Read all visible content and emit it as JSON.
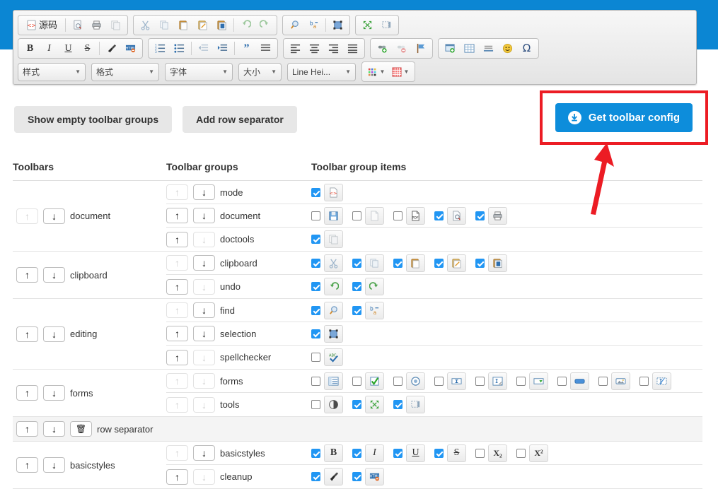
{
  "editor_toolbar": {
    "row1": [
      {
        "group": "document-mode",
        "buttons": [
          {
            "name": "source-button",
            "label": "源码",
            "icon": "source-code-icon"
          },
          {
            "name": "preview-button",
            "label": "",
            "icon": "preview-icon"
          },
          {
            "name": "print-button",
            "label": "",
            "icon": "print-icon"
          },
          {
            "name": "templates-button",
            "label": "",
            "icon": "templates-icon"
          }
        ]
      },
      {
        "group": "clipboard-undo",
        "buttons": [
          {
            "name": "cut-button",
            "label": "",
            "icon": "scissors-icon"
          },
          {
            "name": "copy-button",
            "label": "",
            "icon": "copy-icon"
          },
          {
            "name": "paste-button",
            "label": "",
            "icon": "paste-icon"
          },
          {
            "name": "paste-text-button",
            "label": "",
            "icon": "paste-text-icon"
          },
          {
            "name": "paste-word-button",
            "label": "",
            "icon": "paste-from-word-icon"
          },
          {
            "name": "undo-button",
            "label": "",
            "icon": "undo-icon"
          },
          {
            "name": "redo-button",
            "label": "",
            "icon": "redo-icon"
          }
        ]
      },
      {
        "group": "editing",
        "buttons": [
          {
            "name": "find-button",
            "label": "",
            "icon": "magnifier-icon"
          },
          {
            "name": "replace-button",
            "label": "",
            "icon": "find-replace-icon"
          },
          {
            "name": "select-all-button",
            "label": "",
            "icon": "select-all-icon"
          }
        ]
      },
      {
        "group": "tools",
        "buttons": [
          {
            "name": "maximize-button",
            "label": "",
            "icon": "maximize-icon"
          },
          {
            "name": "show-blocks-button",
            "label": "",
            "icon": "show-blocks-icon"
          }
        ]
      }
    ],
    "row2": [
      {
        "group": "basicstyles-cleanup",
        "buttons": [
          {
            "name": "bold-button",
            "label": "B",
            "icon": "bold-icon"
          },
          {
            "name": "italic-button",
            "label": "I",
            "icon": "italic-icon"
          },
          {
            "name": "underline-button",
            "label": "U",
            "icon": "underline-icon"
          },
          {
            "name": "strike-button",
            "label": "S",
            "icon": "strike-icon"
          },
          {
            "name": "remove-format-button",
            "label": "",
            "icon": "brush-icon"
          },
          {
            "name": "html-cleanup-button",
            "label": "",
            "icon": "html-remove-icon"
          }
        ]
      },
      {
        "group": "list-indent-blockquote",
        "buttons": [
          {
            "name": "numbered-list-button",
            "label": "",
            "icon": "numbered-list-icon"
          },
          {
            "name": "bulleted-list-button",
            "label": "",
            "icon": "bulleted-list-icon"
          },
          {
            "name": "outdent-button",
            "label": "",
            "icon": "outdent-icon"
          },
          {
            "name": "indent-button",
            "label": "",
            "icon": "indent-icon"
          },
          {
            "name": "blockquote-button",
            "label": "",
            "icon": "quote-icon"
          },
          {
            "name": "div-button",
            "label": "",
            "icon": "create-div-icon"
          }
        ]
      },
      {
        "group": "align",
        "buttons": [
          {
            "name": "align-left-button",
            "label": "",
            "icon": "align-left-icon"
          },
          {
            "name": "align-center-button",
            "label": "",
            "icon": "align-center-icon"
          },
          {
            "name": "align-right-button",
            "label": "",
            "icon": "align-right-icon"
          },
          {
            "name": "align-justify-button",
            "label": "",
            "icon": "align-justify-icon"
          }
        ]
      },
      {
        "group": "links",
        "buttons": [
          {
            "name": "link-button",
            "label": "",
            "icon": "link-icon"
          },
          {
            "name": "unlink-button",
            "label": "",
            "icon": "unlink-icon"
          },
          {
            "name": "anchor-button",
            "label": "",
            "icon": "anchor-flag-icon"
          }
        ]
      },
      {
        "group": "insert",
        "buttons": [
          {
            "name": "image-button",
            "label": "",
            "icon": "image-icon"
          },
          {
            "name": "table-button",
            "label": "",
            "icon": "table-icon"
          },
          {
            "name": "horizontal-rule-button",
            "label": "",
            "icon": "horizontal-rule-icon"
          },
          {
            "name": "smiley-button",
            "label": "",
            "icon": "smiley-icon"
          },
          {
            "name": "special-char-button",
            "label": "Ω",
            "icon": "omega-icon"
          }
        ]
      }
    ],
    "row3_combos": [
      {
        "name": "styles-combo",
        "label": "样式"
      },
      {
        "name": "format-combo",
        "label": "格式"
      },
      {
        "name": "font-combo",
        "label": "字体"
      },
      {
        "name": "fontsize-combo",
        "label": "大小"
      },
      {
        "name": "lineheight-combo",
        "label": "Line Hei..."
      }
    ],
    "row3_color": [
      {
        "name": "text-color-button",
        "icon": "text-color-icon"
      },
      {
        "name": "background-color-button",
        "icon": "bg-color-icon"
      }
    ]
  },
  "actions": {
    "show_empty": "Show empty toolbar groups",
    "add_row_separator": "Add row separator",
    "get_toolbar_config": "Get toolbar config",
    "get_config_icon": "download-icon",
    "highlight_color": "#ec1c24",
    "primary_color": "#0d8ddb"
  },
  "table": {
    "headers": {
      "toolbars": "Toolbars",
      "groups": "Toolbar groups",
      "items": "Toolbar group items"
    },
    "rows": [
      {
        "type": "toolbar",
        "name": "document",
        "up_enabled": false,
        "down_enabled": true,
        "groups": [
          {
            "name": "mode",
            "up_enabled": false,
            "down_enabled": true,
            "items": [
              {
                "name": "source",
                "checked": true,
                "icon": "source-code-icon"
              }
            ]
          },
          {
            "name": "document",
            "up_enabled": true,
            "down_enabled": true,
            "items": [
              {
                "name": "save",
                "checked": false,
                "icon": "save-icon"
              },
              {
                "name": "newpage",
                "checked": false,
                "icon": "new-page-icon"
              },
              {
                "name": "exportpdf",
                "checked": false,
                "icon": "pdf-icon"
              },
              {
                "name": "preview",
                "checked": true,
                "icon": "preview-icon"
              },
              {
                "name": "print",
                "checked": true,
                "icon": "print-icon"
              }
            ]
          },
          {
            "name": "doctools",
            "up_enabled": true,
            "down_enabled": false,
            "items": [
              {
                "name": "templates",
                "checked": true,
                "icon": "templates-icon"
              }
            ]
          }
        ]
      },
      {
        "type": "toolbar",
        "name": "clipboard",
        "up_enabled": true,
        "down_enabled": true,
        "groups": [
          {
            "name": "clipboard",
            "up_enabled": false,
            "down_enabled": true,
            "items": [
              {
                "name": "cut",
                "checked": true,
                "icon": "scissors-icon"
              },
              {
                "name": "copy",
                "checked": true,
                "icon": "copy-icon"
              },
              {
                "name": "paste",
                "checked": true,
                "icon": "paste-icon"
              },
              {
                "name": "pastetext",
                "checked": true,
                "icon": "paste-text-icon"
              },
              {
                "name": "pastefromword",
                "checked": true,
                "icon": "paste-from-word-icon"
              }
            ]
          },
          {
            "name": "undo",
            "up_enabled": true,
            "down_enabled": false,
            "items": [
              {
                "name": "undo",
                "checked": true,
                "icon": "undo-icon"
              },
              {
                "name": "redo",
                "checked": true,
                "icon": "redo-icon"
              }
            ]
          }
        ]
      },
      {
        "type": "toolbar",
        "name": "editing",
        "up_enabled": true,
        "down_enabled": true,
        "groups": [
          {
            "name": "find",
            "up_enabled": false,
            "down_enabled": true,
            "items": [
              {
                "name": "find",
                "checked": true,
                "icon": "magnifier-icon"
              },
              {
                "name": "replace",
                "checked": true,
                "icon": "find-replace-icon"
              }
            ]
          },
          {
            "name": "selection",
            "up_enabled": true,
            "down_enabled": true,
            "items": [
              {
                "name": "selectall",
                "checked": true,
                "icon": "select-all-icon"
              }
            ]
          },
          {
            "name": "spellchecker",
            "up_enabled": true,
            "down_enabled": false,
            "items": [
              {
                "name": "spellchecker",
                "checked": false,
                "icon": "spellcheck-icon"
              }
            ]
          }
        ]
      },
      {
        "type": "toolbar",
        "name": "forms",
        "up_enabled": true,
        "down_enabled": true,
        "groups": [
          {
            "name": "forms",
            "up_enabled": false,
            "down_enabled": false,
            "items": [
              {
                "name": "form",
                "checked": false,
                "icon": "form-icon"
              },
              {
                "name": "checkbox",
                "checked": false,
                "icon": "checkbox-icon"
              },
              {
                "name": "radio",
                "checked": false,
                "icon": "radio-icon"
              },
              {
                "name": "textfield",
                "checked": false,
                "icon": "text-field-icon"
              },
              {
                "name": "textarea",
                "checked": false,
                "icon": "textarea-icon"
              },
              {
                "name": "select",
                "checked": false,
                "icon": "select-field-icon"
              },
              {
                "name": "button",
                "checked": false,
                "icon": "button-icon"
              },
              {
                "name": "imagebutton",
                "checked": false,
                "icon": "image-button-icon"
              },
              {
                "name": "hiddenfield",
                "checked": false,
                "icon": "hidden-field-icon"
              }
            ]
          },
          {
            "name": "tools",
            "up_enabled": false,
            "down_enabled": false,
            "items": [
              {
                "name": "uicolor",
                "checked": false,
                "icon": "ui-color-icon"
              },
              {
                "name": "maximize",
                "checked": true,
                "icon": "maximize-icon"
              },
              {
                "name": "showblocks",
                "checked": true,
                "icon": "show-blocks-icon"
              }
            ]
          }
        ]
      },
      {
        "type": "separator",
        "name": "row separator",
        "up_enabled": true,
        "down_enabled": true,
        "delete_icon": "trash-icon"
      },
      {
        "type": "toolbar",
        "name": "basicstyles",
        "up_enabled": true,
        "down_enabled": true,
        "groups": [
          {
            "name": "basicstyles",
            "up_enabled": false,
            "down_enabled": true,
            "items": [
              {
                "name": "bold",
                "checked": true,
                "icon": "bold-icon",
                "glyph": "B"
              },
              {
                "name": "italic",
                "checked": true,
                "icon": "italic-icon",
                "glyph": "I"
              },
              {
                "name": "underline",
                "checked": true,
                "icon": "underline-icon",
                "glyph": "U"
              },
              {
                "name": "strike",
                "checked": true,
                "icon": "strike-icon",
                "glyph": "S"
              },
              {
                "name": "subscript",
                "checked": false,
                "icon": "subscript-icon",
                "glyph": "X₂"
              },
              {
                "name": "superscript",
                "checked": false,
                "icon": "superscript-icon",
                "glyph": "X²"
              }
            ]
          },
          {
            "name": "cleanup",
            "up_enabled": true,
            "down_enabled": false,
            "items": [
              {
                "name": "removeformat",
                "checked": true,
                "icon": "brush-icon"
              },
              {
                "name": "htmlcleanup",
                "checked": true,
                "icon": "html-remove-icon"
              }
            ]
          }
        ]
      }
    ]
  },
  "icons": {
    "arrow_up": "↑",
    "arrow_down": "↓",
    "trash": "🗑",
    "caret_down": "▼"
  }
}
